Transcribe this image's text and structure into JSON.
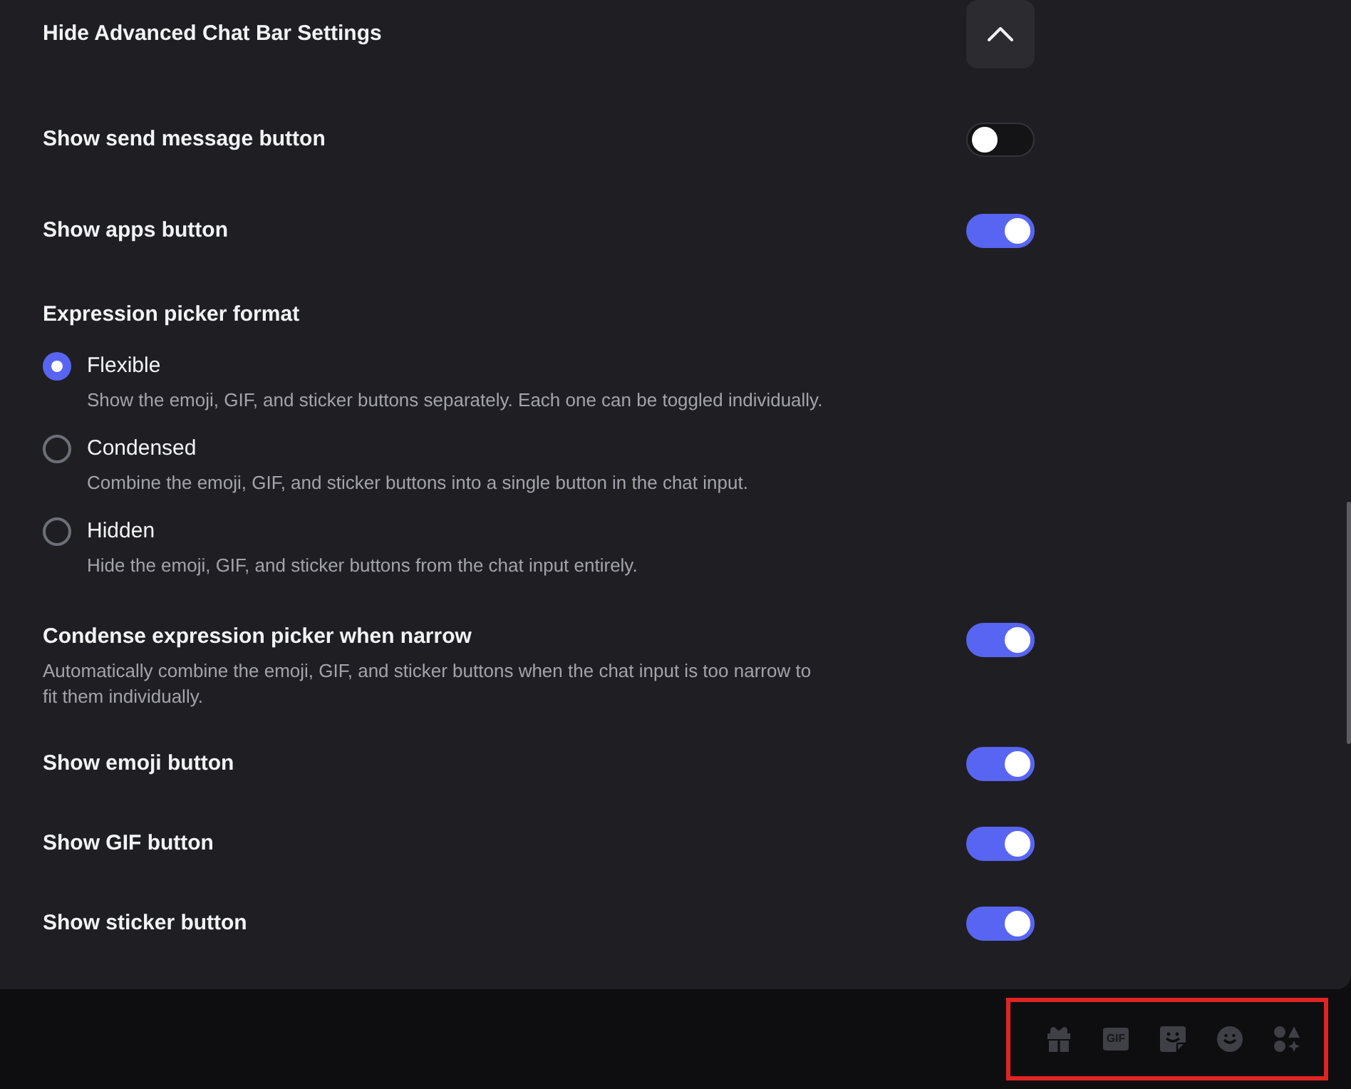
{
  "header": {
    "title": "Hide Advanced Chat Bar Settings",
    "expanded": true
  },
  "top_toggles": [
    {
      "label": "Show send message button",
      "on": false
    },
    {
      "label": "Show apps button",
      "on": true
    }
  ],
  "expression_picker": {
    "title": "Expression picker format",
    "options": [
      {
        "label": "Flexible",
        "description": "Show the emoji, GIF, and sticker buttons separately. Each one can be toggled individually.",
        "selected": true
      },
      {
        "label": "Condensed",
        "description": "Combine the emoji, GIF, and sticker buttons into a single button in the chat input.",
        "selected": false
      },
      {
        "label": "Hidden",
        "description": "Hide the emoji, GIF, and sticker buttons from the chat input entirely.",
        "selected": false
      }
    ]
  },
  "bottom_toggles": [
    {
      "label": "Condense expression picker when narrow",
      "description": "Automatically combine the emoji, GIF, and sticker buttons when the chat input is too narrow to fit them individually.",
      "on": true
    },
    {
      "label": "Show emoji button",
      "on": true
    },
    {
      "label": "Show GIF button",
      "on": true
    },
    {
      "label": "Show sticker button",
      "on": true
    }
  ],
  "chat_bar": {
    "highlighted": true,
    "buttons": [
      {
        "kind": "gift"
      },
      {
        "kind": "gif",
        "text": "GIF"
      },
      {
        "kind": "sticker"
      },
      {
        "kind": "emoji"
      },
      {
        "kind": "apps"
      }
    ]
  }
}
